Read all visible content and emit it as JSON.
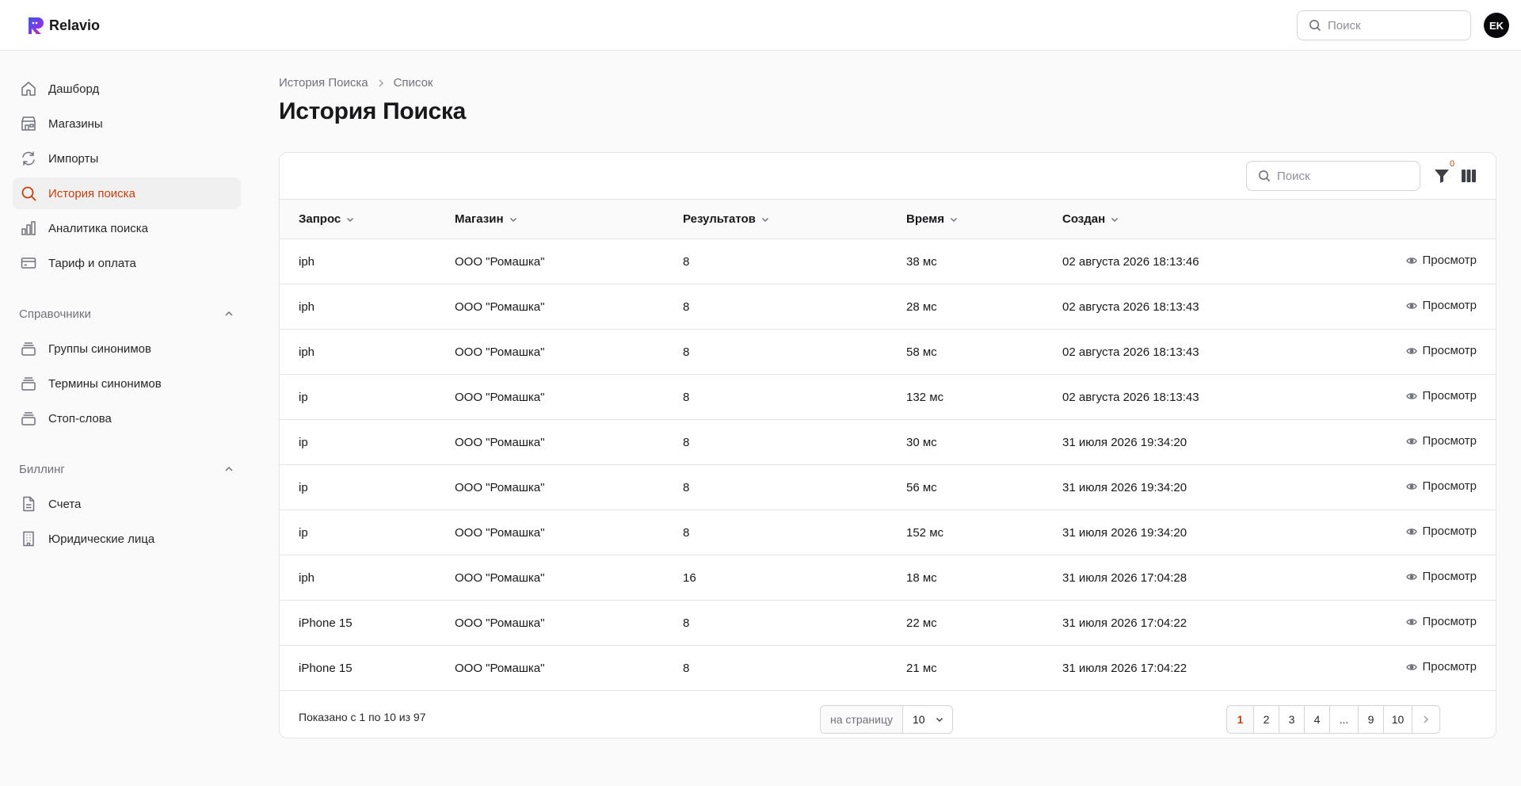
{
  "app": {
    "name": "Relavio",
    "avatar_initials": "EK",
    "accent_color": "#c2410c",
    "logo_colors": [
      "#3b5bdb",
      "#7c3aed",
      "#db2777"
    ]
  },
  "header": {
    "search_placeholder": "Поиск"
  },
  "sidebar": {
    "items": [
      {
        "label": "Дашборд",
        "icon": "home-icon"
      },
      {
        "label": "Магазины",
        "icon": "store-icon"
      },
      {
        "label": "Импорты",
        "icon": "refresh-icon"
      },
      {
        "label": "История поиска",
        "icon": "search-icon",
        "active": true
      },
      {
        "label": "Аналитика поиска",
        "icon": "bar-chart-icon"
      },
      {
        "label": "Тариф и оплата",
        "icon": "credit-card-icon"
      }
    ],
    "sections": [
      {
        "title": "Справочники",
        "items": [
          {
            "label": "Группы синонимов",
            "icon": "stack-icon"
          },
          {
            "label": "Термины синонимов",
            "icon": "stack-icon"
          },
          {
            "label": "Стоп-слова",
            "icon": "stack-icon"
          }
        ]
      },
      {
        "title": "Биллинг",
        "items": [
          {
            "label": "Счета",
            "icon": "document-icon"
          },
          {
            "label": "Юридические лица",
            "icon": "building-icon"
          }
        ]
      }
    ]
  },
  "breadcrumb": {
    "parent": "История Поиска",
    "current": "Список"
  },
  "page": {
    "title": "История Поиска"
  },
  "table": {
    "search_placeholder": "Поиск",
    "filter_count": "0",
    "columns": [
      "Запрос",
      "Магазин",
      "Результатов",
      "Время",
      "Создан"
    ],
    "action_label": "Просмотр",
    "rows": [
      {
        "query": "iph",
        "shop": "ООО \"Ромашка\"",
        "results": "8",
        "time": "38 мс",
        "created": "02 августа 2026 18:13:46"
      },
      {
        "query": "iph",
        "shop": "ООО \"Ромашка\"",
        "results": "8",
        "time": "28 мс",
        "created": "02 августа 2026 18:13:43"
      },
      {
        "query": "iph",
        "shop": "ООО \"Ромашка\"",
        "results": "8",
        "time": "58 мс",
        "created": "02 августа 2026 18:13:43"
      },
      {
        "query": "ip",
        "shop": "ООО \"Ромашка\"",
        "results": "8",
        "time": "132 мс",
        "created": "02 августа 2026 18:13:43"
      },
      {
        "query": "ip",
        "shop": "ООО \"Ромашка\"",
        "results": "8",
        "time": "30 мс",
        "created": "31 июля 2026 19:34:20"
      },
      {
        "query": "ip",
        "shop": "ООО \"Ромашка\"",
        "results": "8",
        "time": "56 мс",
        "created": "31 июля 2026 19:34:20"
      },
      {
        "query": "ip",
        "shop": "ООО \"Ромашка\"",
        "results": "8",
        "time": "152 мс",
        "created": "31 июля 2026 19:34:20"
      },
      {
        "query": "iph",
        "shop": "ООО \"Ромашка\"",
        "results": "16",
        "time": "18 мс",
        "created": "31 июля 2026 17:04:28"
      },
      {
        "query": "iPhone 15",
        "shop": "ООО \"Ромашка\"",
        "results": "8",
        "time": "22 мс",
        "created": "31 июля 2026 17:04:22"
      },
      {
        "query": "iPhone 15",
        "shop": "ООО \"Ромашка\"",
        "results": "8",
        "time": "21 мс",
        "created": "31 июля 2026 17:04:22"
      }
    ]
  },
  "footer": {
    "showing": "Показано с 1 по 10 из 97",
    "per_page_label": "на страницу",
    "per_page_value": "10",
    "pages": [
      "1",
      "2",
      "3",
      "4",
      "...",
      "9",
      "10"
    ],
    "current_page": "1"
  }
}
